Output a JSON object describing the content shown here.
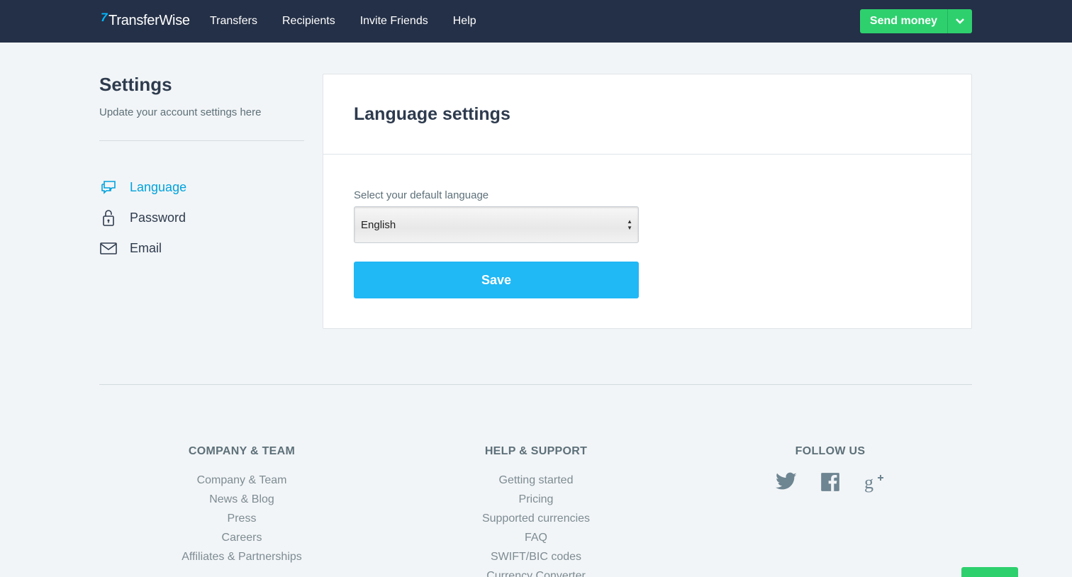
{
  "header": {
    "logo_mark": "7",
    "logo_text": "TransferWise",
    "nav": [
      "Transfers",
      "Recipients",
      "Invite Friends",
      "Help"
    ],
    "send_label": "Send money"
  },
  "sidebar": {
    "title": "Settings",
    "subtitle": "Update your account settings here",
    "items": [
      {
        "label": "Language",
        "icon": "chat-bubbles-icon",
        "active": true
      },
      {
        "label": "Password",
        "icon": "lock-icon",
        "active": false
      },
      {
        "label": "Email",
        "icon": "envelope-icon",
        "active": false
      }
    ]
  },
  "main": {
    "title": "Language settings",
    "field_label": "Select your default language",
    "selected_language": "English",
    "save_label": "Save"
  },
  "footer": {
    "company": {
      "heading": "COMPANY & TEAM",
      "links": [
        "Company & Team",
        "News & Blog",
        "Press",
        "Careers",
        "Affiliates & Partnerships"
      ]
    },
    "help": {
      "heading": "HELP & SUPPORT",
      "links": [
        "Getting started",
        "Pricing",
        "Supported currencies",
        "FAQ",
        "SWIFT/BIC codes",
        "Currency Converter"
      ]
    },
    "follow": {
      "heading": "FOLLOW US",
      "icons": [
        "twitter-icon",
        "facebook-icon",
        "google-plus-icon"
      ]
    }
  },
  "colors": {
    "nav_bg": "#243047",
    "accent": "#00b9ff",
    "save_button": "#20b8f5",
    "send_button": "#2ed06e",
    "active_link": "#00a2dd"
  }
}
